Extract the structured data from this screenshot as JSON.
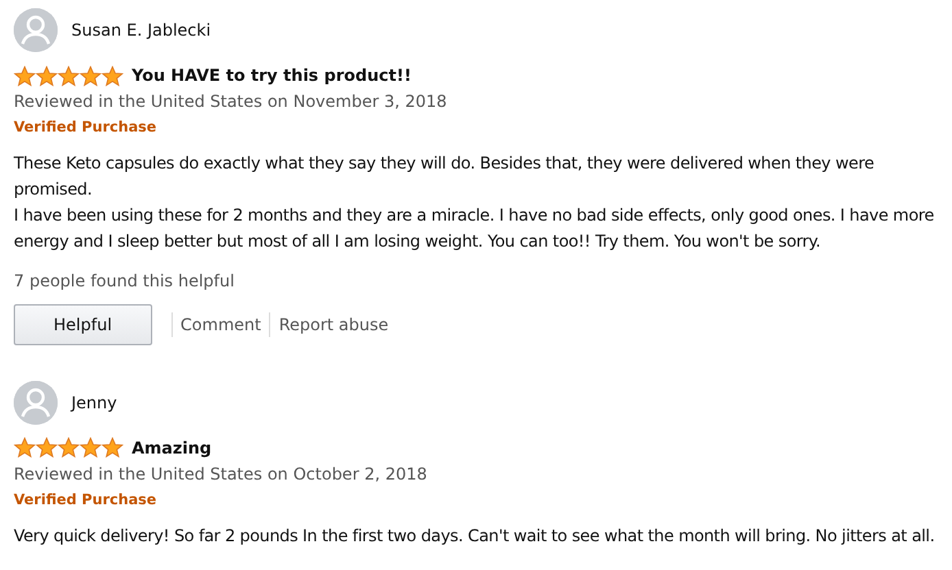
{
  "reviews": [
    {
      "author": "Susan E. Jablecki",
      "stars": 5,
      "title": "You HAVE to try this product!!",
      "date": "Reviewed in the United States on November 3, 2018",
      "badge": "Verified Purchase",
      "body": [
        "These Keto capsules do exactly what they say they will do. Besides that, they were delivered when they were promised.",
        "I have been using these for 2 months and they are a miracle. I have no bad side effects, only good ones. I have more energy and I sleep better but most of all I am losing weight. You can too!! Try them. You won't be sorry."
      ],
      "helpful_count": "7 people found this helpful",
      "actions": [
        {
          "kind": "button",
          "label": "Helpful"
        },
        {
          "kind": "link",
          "label": "Comment"
        },
        {
          "kind": "link",
          "label": "Report abuse"
        }
      ]
    },
    {
      "author": "Jenny",
      "stars": 5,
      "title": "Amazing",
      "date": "Reviewed in the United States on October 2, 2018",
      "badge": "Verified Purchase",
      "body": [
        "Very quick delivery! So far 2 pounds In the first two days. Can't wait to see what the month will bring. No jitters at all."
      ]
    }
  ]
}
